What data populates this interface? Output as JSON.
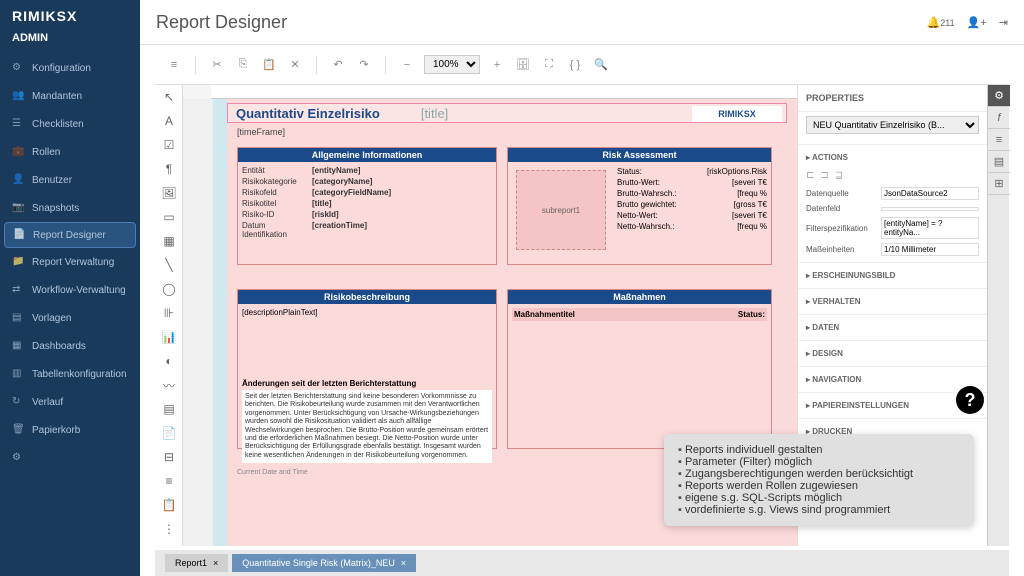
{
  "app": {
    "logo": "RIMIKSX",
    "admin": "ADMIN"
  },
  "nav": {
    "items": [
      {
        "label": "Konfiguration"
      },
      {
        "label": "Mandanten"
      },
      {
        "label": "Checklisten"
      },
      {
        "label": "Rollen"
      },
      {
        "label": "Benutzer"
      },
      {
        "label": "Snapshots"
      },
      {
        "label": "Report Designer"
      },
      {
        "label": "Report Verwaltung"
      },
      {
        "label": "Workflow-Verwaltung"
      },
      {
        "label": "Vorlagen"
      },
      {
        "label": "Dashboards"
      },
      {
        "label": "Tabellenkonfiguration"
      },
      {
        "label": "Verlauf"
      },
      {
        "label": "Papierkorb"
      }
    ]
  },
  "header": {
    "title": "Report Designer",
    "notif_count": "211"
  },
  "toolbar": {
    "zoom": "100%"
  },
  "report": {
    "title": "Quantitativ Einzelrisiko",
    "title_placeholder": "[title]",
    "logo": "RIMIKSX",
    "timeframe": "[timeFrame]",
    "panel1": {
      "header": "Allgemeine Informationen",
      "rows": [
        {
          "label": "Entität",
          "value": "[entityName]"
        },
        {
          "label": "Risikokategorie",
          "value": "[categoryName]"
        },
        {
          "label": "Risikofeld",
          "value": "[categoryFieldName]"
        },
        {
          "label": "Risikotitel",
          "value": "[title]"
        },
        {
          "label": "Risiko-ID",
          "value": "[riskId]"
        },
        {
          "label": "Datum Identifikation",
          "value": "[creationTime]"
        }
      ]
    },
    "panel2": {
      "header": "Risk Assessment",
      "subreport": "subreport1",
      "rows": [
        {
          "label": "Status:",
          "value": "[riskOptions.Risk"
        },
        {
          "label": "Brutto-Wert:",
          "value": "[severi T€"
        },
        {
          "label": "Brutto-Wahrsch.:",
          "value": "[frequ %"
        },
        {
          "label": "Brutto gewichtet:",
          "value": "[gross T€"
        },
        {
          "label": "Netto-Wert:",
          "value": "[severi T€"
        },
        {
          "label": "Netto-Wahrsch.:",
          "value": "[frequ %"
        }
      ]
    },
    "panel3": {
      "header": "Risikobeschreibung",
      "desc": "[descriptionPlainText]",
      "changes_header": "Änderungen seit der letzten Berichterstattung",
      "changes_text": "Seit der letzten Berichterstattung sind keine besonderen Vorkommnisse zu berichten. Die Risikobeurteilung wurde zusammen mit den Verantwortlichen vorgenommen. Unter Berücksichtigung von Ursache-Wirkungsbeziehungen wurden sowohl die Risikosituation validiert als auch allfällige Wechselwirkungen besprochen. Die Brutto-Position wurde gemeinsam erörtert und die erforderlichen Maßnahmen besiegt. Die Netto-Position wurde unter Berücksichtigung der Erfüllungsgrade ebenfalls bestätigt. Insgesamt wurden keine wesentlichen Änderungen in der Risikobeurteilung vorgenommen."
    },
    "panel4": {
      "header": "Maßnahmen",
      "col1": "Maßnahmentitel",
      "col2": "Status:"
    },
    "footer_date": "Current Date and Time"
  },
  "props": {
    "header": "PROPERTIES",
    "selected": "NEU Quantitativ Einzelrisiko (B...",
    "actions_header": "ACTIONS",
    "fields": [
      {
        "label": "Datenquelle",
        "value": "JsonDataSource2"
      },
      {
        "label": "Datenfeld",
        "value": ""
      },
      {
        "label": "Filterspezifikation",
        "value": "[entityName] = ?entityNa..."
      },
      {
        "label": "Maßeinheiten",
        "value": "1/10 Millimeter"
      }
    ],
    "sections": [
      "ERSCHEINUNGSBILD",
      "VERHALTEN",
      "DATEN",
      "DESIGN",
      "NAVIGATION",
      "PAPIEREINSTELLUNGEN",
      "DRUCKEN"
    ]
  },
  "tabs": [
    {
      "label": "Report1"
    },
    {
      "label": "Quantitative Single Risk (Matrix)_NEU"
    }
  ],
  "tooltip": {
    "items": [
      "Reports individuell gestalten",
      "Parameter (Filter) möglich",
      "Zugangsberechtigungen werden berücksichtigt",
      "Reports werden Rollen zugewiesen",
      "eigene s.g. SQL-Scripts möglich",
      "vordefinierte s.g. Views sind programmiert"
    ]
  }
}
